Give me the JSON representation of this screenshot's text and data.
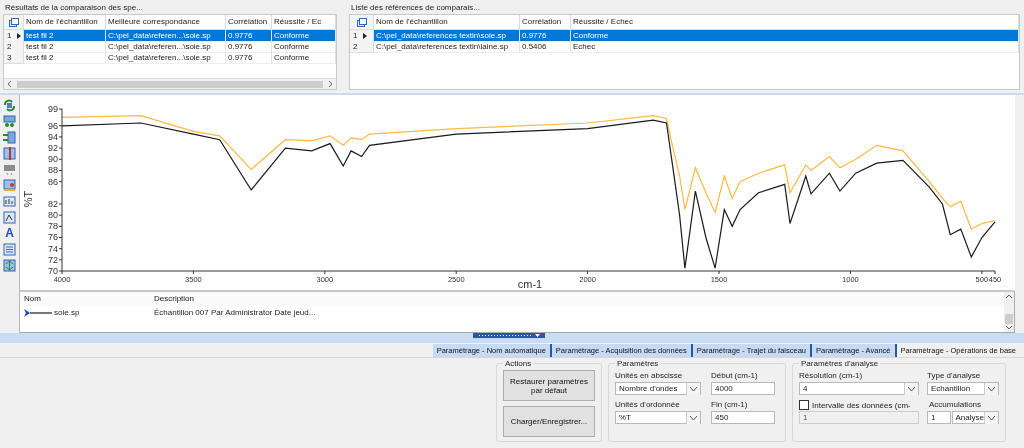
{
  "results": {
    "title": "Résultats de la comparaison des spe...",
    "columns": [
      "Nom de l'échantillon",
      "Meilleure correspondance",
      "Corrélation",
      "Réussite / Ec"
    ],
    "rows": [
      {
        "index": "1",
        "selected": true,
        "cells": [
          "test fil 2",
          "C:\\pel_data\\referen...\\soie.sp",
          "0.9776",
          "Conforme"
        ]
      },
      {
        "index": "2",
        "selected": false,
        "cells": [
          "test fil 2",
          "C:\\pel_data\\referen...\\soie.sp",
          "0.9776",
          "Conforme"
        ]
      },
      {
        "index": "3",
        "selected": false,
        "cells": [
          "test fil 2",
          "C:\\pel_data\\referen...\\soie.sp",
          "0.9776",
          "Conforme"
        ]
      }
    ]
  },
  "references": {
    "title": "Liste des références de comparais...",
    "columns": [
      "Nom de l'échantillon",
      "Corrélation",
      "Réussite / Echec"
    ],
    "rows": [
      {
        "index": "1",
        "selected": true,
        "cells": [
          "C:\\pel_data\\references textin\\soie.sp",
          "0.9776",
          "Conforme"
        ]
      },
      {
        "index": "2",
        "selected": false,
        "cells": [
          "C:\\pel_data\\references textin\\laine.sp",
          "0.5406",
          "Echec"
        ]
      }
    ]
  },
  "toolbar": [
    {
      "kind": "refresh"
    },
    {
      "kind": "stack"
    },
    {
      "kind": "swap"
    },
    {
      "kind": "ruler"
    },
    {
      "kind": "printer"
    },
    {
      "kind": "overlay"
    },
    {
      "kind": "peaks"
    },
    {
      "kind": "zoom"
    },
    {
      "kind": "glyph",
      "label": "A"
    },
    {
      "kind": "list"
    },
    {
      "kind": "fit"
    }
  ],
  "spectrum": {
    "chart_data": {
      "type": "line",
      "xlabel": "cm-1",
      "ylabel": "%T",
      "x": [
        4000,
        3700,
        3500,
        3400,
        3280,
        3150,
        3050,
        2980,
        2930,
        2900,
        2860,
        2830,
        2500,
        2000,
        1750,
        1700,
        1680,
        1650,
        1630,
        1590,
        1550,
        1515,
        1480,
        1450,
        1420,
        1350,
        1250,
        1230,
        1170,
        1150,
        1080,
        1040,
        980,
        900,
        800,
        700,
        650,
        620,
        580,
        540,
        500,
        450
      ],
      "series": [
        {
          "color": "#1a1a1a",
          "values": [
            96,
            96.5,
            94.5,
            93.5,
            84.5,
            92,
            91.5,
            92.8,
            88.8,
            91.5,
            90.5,
            92.5,
            94.5,
            95.5,
            97,
            96.5,
            90,
            80,
            70.5,
            84.3,
            76,
            70.5,
            81,
            78,
            81,
            84,
            85.5,
            78.5,
            87,
            83.8,
            87.5,
            84.3,
            87.5,
            89.3,
            89.8,
            85,
            82,
            76.5,
            77.5,
            72.5,
            76,
            78.8
          ]
        },
        {
          "color": "#ffb940",
          "values": [
            97.5,
            97.8,
            95,
            94.2,
            88.2,
            93.5,
            93.3,
            94.2,
            92.5,
            93.8,
            93.5,
            94.5,
            95.5,
            96.5,
            97.8,
            97.3,
            93,
            87,
            81,
            88.5,
            84,
            80.5,
            87,
            83,
            86,
            87.5,
            89,
            84,
            89,
            88,
            90.5,
            88.5,
            90,
            92.5,
            91.5,
            86,
            83,
            81.5,
            82.5,
            77.5,
            78.5,
            79
          ]
        }
      ],
      "xlim": [
        4000,
        450
      ],
      "ylim": [
        70,
        99
      ],
      "xticks": [
        4000,
        3500,
        3000,
        2500,
        2000,
        1500,
        1000,
        500,
        450
      ],
      "yticks": [
        70,
        72,
        74,
        76,
        78,
        80,
        82,
        86,
        88,
        90,
        92,
        94,
        96,
        99
      ]
    }
  },
  "legend": {
    "columns": [
      "Nom",
      "Description"
    ],
    "rows": [
      {
        "name": "soie.sp",
        "description": "Échantillon 007 Par Administrator Date jeud..."
      }
    ]
  },
  "tabs": [
    {
      "label": "Paramétrage - Nom automatique",
      "selected": false
    },
    {
      "label": "Paramétrage - Acquisition des données",
      "selected": false
    },
    {
      "label": "Paramétrage - Trajet du faisceau",
      "selected": false
    },
    {
      "label": "Paramétrage - Avancé",
      "selected": false
    },
    {
      "label": "Paramétrage - Opérations de base",
      "selected": true
    }
  ],
  "actions": {
    "title": "Actions",
    "buttons": [
      "Restaurer paramètres par défaut",
      "Charger/Enregistrer..."
    ]
  },
  "parameters": {
    "title": "Paramètres",
    "fields": [
      {
        "label": "Unités en abscisse",
        "kind": "select",
        "value": "Nombre d'ondes"
      },
      {
        "label": "Début (cm-1)",
        "kind": "text",
        "value": "4000"
      },
      {
        "label": "Unités d'ordonnée",
        "kind": "select",
        "value": "%T"
      },
      {
        "label": "Fin (cm-1)",
        "kind": "text",
        "value": "450"
      }
    ]
  },
  "analysis": {
    "title": "Paramètres d'analyse",
    "resolution": {
      "label": "Résolution (cm-1)",
      "value": "4"
    },
    "type": {
      "label": "Type d'analyse",
      "value": "Echantillon"
    },
    "interval": {
      "label": "Intervalle des données (cm-",
      "checked": false,
      "value": "1",
      "disabled": true
    },
    "accumulations": {
      "label": "Accumulations",
      "value": "1",
      "unit": "Analyse"
    }
  }
}
